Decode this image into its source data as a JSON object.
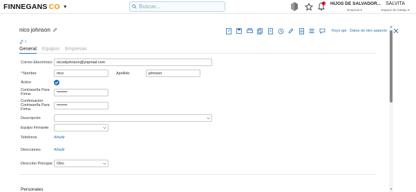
{
  "header": {
    "logo_text": "FINNEGANS",
    "logo_co": "CO",
    "search_placeholder": "Buscar...",
    "company_name": "HIJOS DE SALVADOR...",
    "company_sub": "Empresa ▾",
    "workspace_name": "SALVITA",
    "workspace_sub": "Espacio de trabajo ▾",
    "notification_count": "1"
  },
  "form": {
    "title": "nico johnson",
    "toolbar": {
      "link1": "Keys api",
      "link2": "Datos de otro aspecto"
    },
    "tabs": [
      "General",
      "Equipos",
      "Empresas"
    ],
    "fields": {
      "email_label": "Correo Electrónico",
      "email_value": "nicoeljohnson@yopmail.com",
      "name_label": "Nombre",
      "name_value": "nico",
      "surname_label": "Apellido",
      "surname_value": "johnson",
      "active_label": "Activo",
      "password_label": "Contraseña Para Firma",
      "password_value": "••••••••",
      "confirm_label": "Confirmación Contraseña Para Firma",
      "confirm_value": "••••••••",
      "description_label": "Descripción",
      "description_value": "",
      "signing_team_label": "Equipo Firmante",
      "signing_team_value": "",
      "phones_label": "Telefonos",
      "phones_add": "Añadir",
      "addresses_label": "Direcciones",
      "addresses_add": "Añadir",
      "main_address_label": "Dirección Principal",
      "main_address_value": "Otro"
    },
    "section_title": "Personales"
  },
  "colors": {
    "accent": "#1f6fb8",
    "brand_orange": "#f39200",
    "required": "#d0021b"
  }
}
